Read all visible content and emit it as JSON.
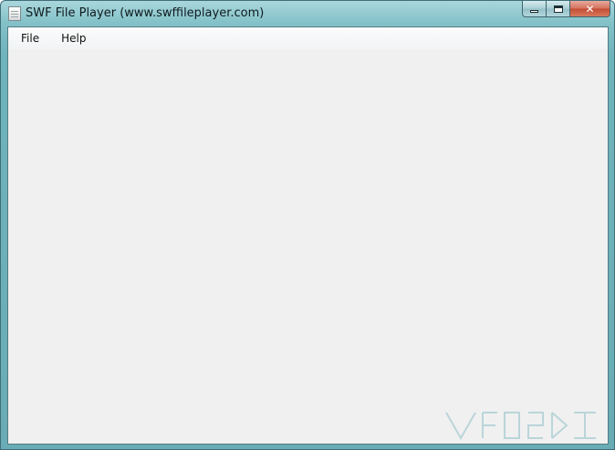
{
  "window": {
    "title": "SWF File Player (www.swffileplayer.com)"
  },
  "titlebar": {
    "app_icon": "document-icon",
    "buttons": {
      "minimize_icon": "minimize-icon",
      "maximize_icon": "maximize-icon",
      "close_label": "✕"
    }
  },
  "menubar": {
    "items": [
      {
        "label": "File"
      },
      {
        "label": "Help"
      }
    ]
  },
  "colors": {
    "frame": "#83c1c8",
    "client_background": "#f0f0f0",
    "close_button": "#c24b33"
  }
}
